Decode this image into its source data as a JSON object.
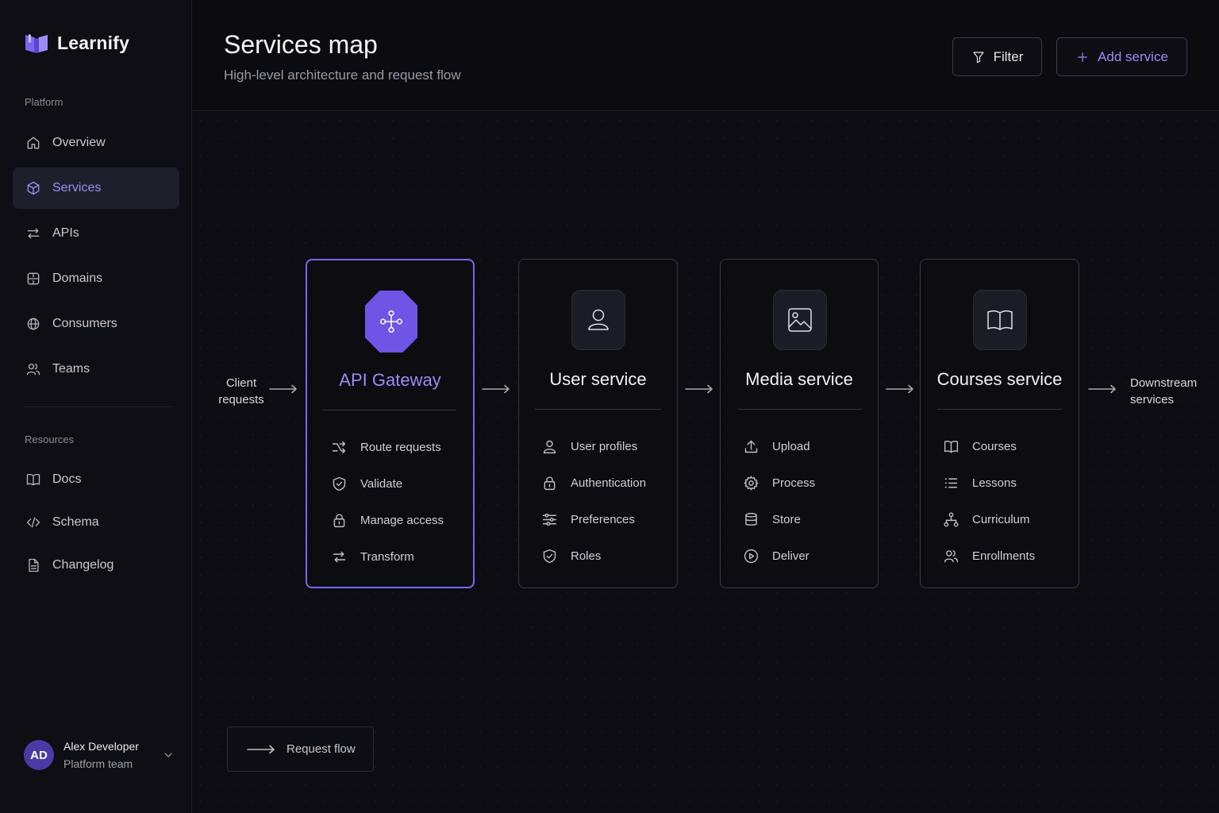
{
  "brand": {
    "name": "Learnify",
    "logo_icon": "book-logo-icon",
    "accent": "#7c68ee"
  },
  "sidebar": {
    "platform_label": "Platform",
    "platform_items": [
      {
        "label": "Overview",
        "icon": "home-icon"
      },
      {
        "label": "Services",
        "icon": "cube-icon",
        "active": true
      },
      {
        "label": "APIs",
        "icon": "arrows-exchange-icon"
      },
      {
        "label": "Domains",
        "icon": "domain-icon"
      },
      {
        "label": "Consumers",
        "icon": "globe-icon"
      },
      {
        "label": "Teams",
        "icon": "users-icon"
      }
    ],
    "resources_label": "Resources",
    "resource_items": [
      {
        "label": "Docs",
        "icon": "book-icon"
      },
      {
        "label": "Schema",
        "icon": "code-icon"
      },
      {
        "label": "Changelog",
        "icon": "file-icon"
      }
    ],
    "user": {
      "initials": "AD",
      "name": "Alex Developer",
      "team": "Platform team"
    }
  },
  "header": {
    "title": "Services map",
    "subtitle": "High-level architecture and request flow",
    "filter_label": "Filter",
    "add_label": "Add service"
  },
  "flow": {
    "input_label": "Client requests",
    "output_label": "Downstream services",
    "services": [
      {
        "name": "API Gateway",
        "icon": "gateway-icon",
        "highlight": true,
        "features": [
          "Route requests",
          "Validate",
          "Manage access",
          "Transform"
        ]
      },
      {
        "name": "User service",
        "icon": "user-icon",
        "features": [
          "User profiles",
          "Authentication",
          "Preferences",
          "Roles"
        ]
      },
      {
        "name": "Media service",
        "icon": "image-icon",
        "features": [
          "Upload",
          "Process",
          "Store",
          "Deliver"
        ]
      },
      {
        "name": "Courses service",
        "icon": "book-open-icon",
        "features": [
          "Courses",
          "Lessons",
          "Curriculum",
          "Enrollments"
        ]
      }
    ]
  },
  "legend": {
    "label": "Request flow"
  }
}
